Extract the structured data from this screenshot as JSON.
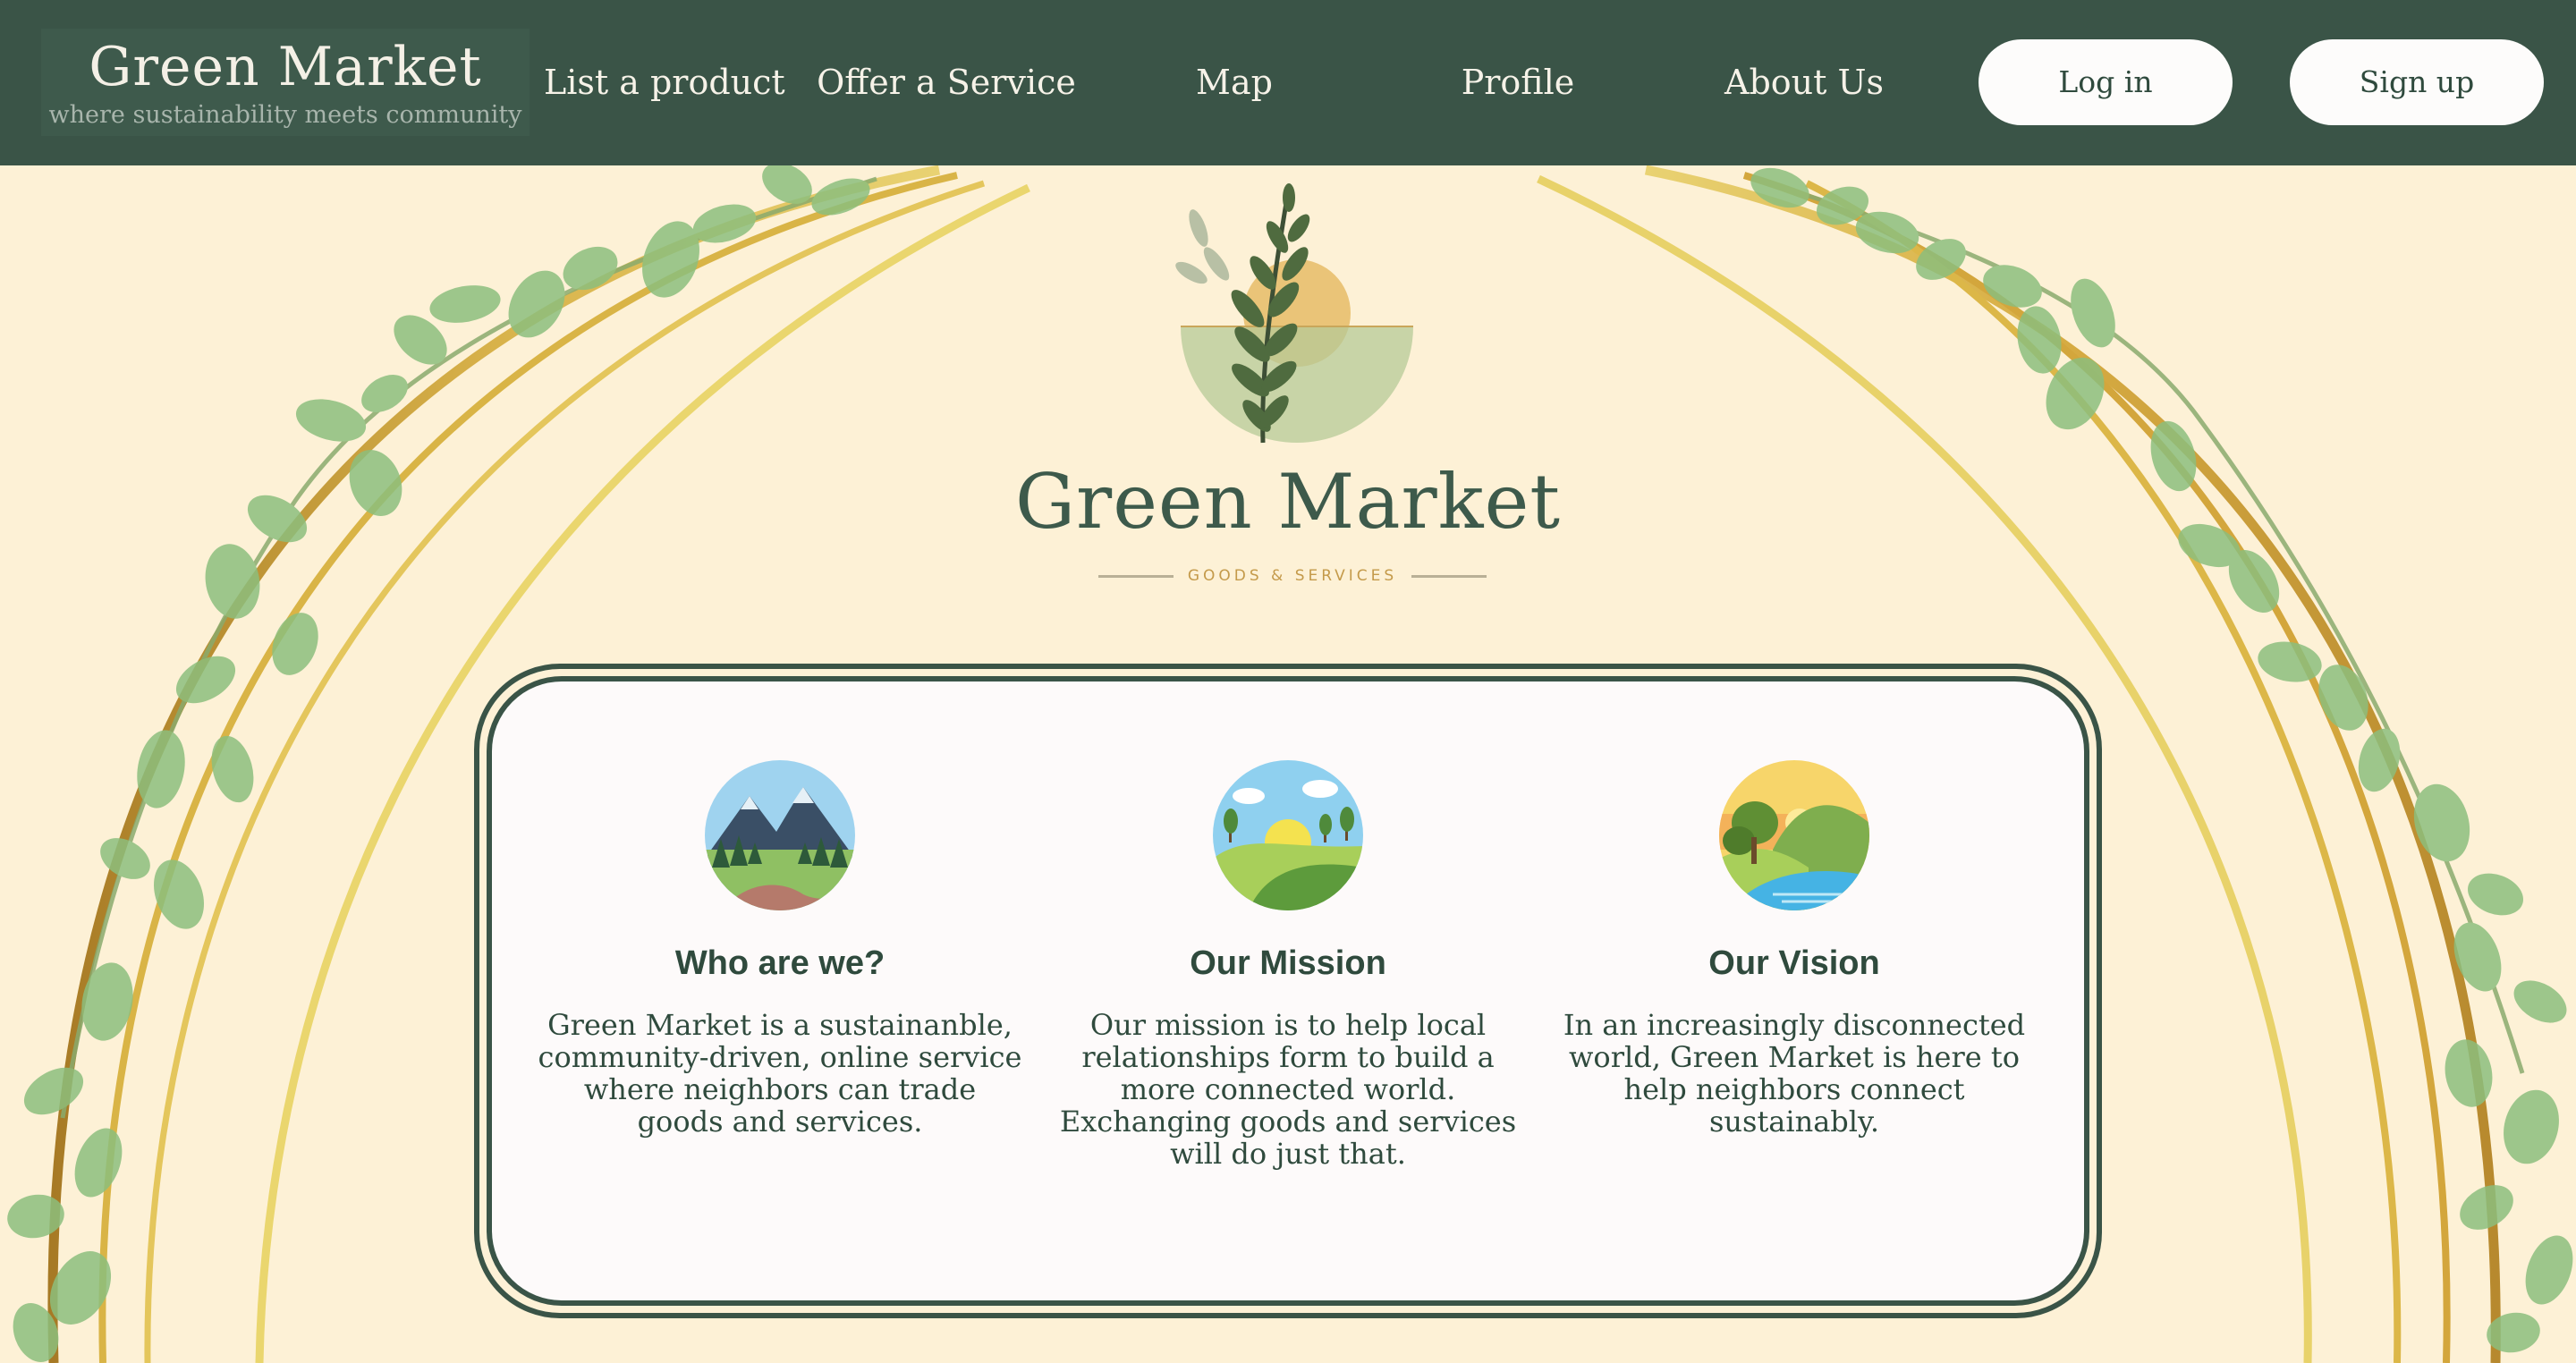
{
  "nav": {
    "brand_title": "Green Market",
    "brand_tagline": "where sustainability meets community",
    "links": [
      "List a product",
      "Offer a Service",
      "Map",
      "Profile",
      "About Us"
    ],
    "login_label": "Log in",
    "signup_label": "Sign up"
  },
  "hero": {
    "title": "Green Market",
    "subtitle": "GOODS & SERVICES",
    "logo_icon": "branch-sun-logo"
  },
  "about": [
    {
      "icon": "mountain-landscape-icon",
      "heading": "Who are we?",
      "body": "Green Market is a sustainanble, community-driven, online service where neighbors can trade goods and services."
    },
    {
      "icon": "sunny-hills-icon",
      "heading": "Our Mission",
      "body": "Our mission is to help local relationships form to build a more connected world. Exchanging goods and services will do just that."
    },
    {
      "icon": "lake-valley-icon",
      "heading": "Our Vision",
      "body": "In an increasingly disconnected world, Green Market is here to help neighbors connect sustainably."
    }
  ],
  "colors": {
    "nav_bg": "#3a5447",
    "page_bg": "#fdf1d6",
    "card_bg": "#fdfafa",
    "accent_gold": "#c49a4a",
    "text_green": "#2f4a3d"
  }
}
